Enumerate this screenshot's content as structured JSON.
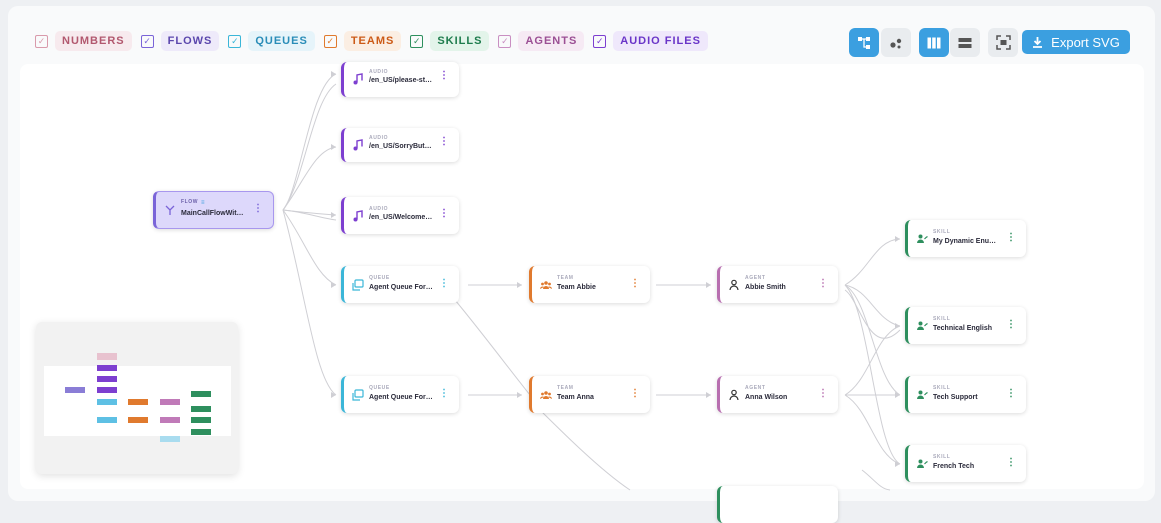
{
  "filters": [
    {
      "label": "NUMBERS",
      "checked": true,
      "color": "#b2586f",
      "bg": "#f7eaee"
    },
    {
      "label": "FLOWS",
      "checked": true,
      "color": "#5a46ad",
      "bg": "#eeeafa"
    },
    {
      "label": "QUEUES",
      "checked": true,
      "color": "#2a8db8",
      "bg": "#e6f4fa"
    },
    {
      "label": "TEAMS",
      "checked": true,
      "color": "#cc5a17",
      "bg": "#fbeee3"
    },
    {
      "label": "SKILLS",
      "checked": true,
      "color": "#1e7c4d",
      "bg": "#e3f4ea"
    },
    {
      "label": "AGENTS",
      "checked": true,
      "color": "#9b4f94",
      "bg": "#f6eaf4"
    },
    {
      "label": "AUDIO FILES",
      "checked": true,
      "color": "#6a35c8",
      "bg": "#efe8fb"
    }
  ],
  "toolbar": {
    "layout_tree_icon": "tree-layout-icon",
    "layout_graph_icon": "graph-layout-icon",
    "columns_icon": "columns-icon",
    "rows_icon": "rows-icon",
    "fit_icon": "fit-view-icon",
    "export_label": "Export SVG"
  },
  "nodes": {
    "audio1": {
      "type": "AUDIO",
      "label": "/en_US/please-st…"
    },
    "audio2": {
      "type": "AUDIO",
      "label": "/en_US/SorryBut…"
    },
    "flow": {
      "type": "FLOW",
      "label": "MainCallFlowWit…"
    },
    "audio3": {
      "type": "AUDIO",
      "label": "/en_US/Welcome…"
    },
    "queue1": {
      "type": "QUEUE",
      "label": "Agent Queue For…"
    },
    "queue2": {
      "type": "QUEUE",
      "label": "Agent Queue For…"
    },
    "team1": {
      "type": "TEAM",
      "label": "Team Abbie"
    },
    "team2": {
      "type": "TEAM",
      "label": "Team Anna"
    },
    "agent1": {
      "type": "AGENT",
      "label": "Abbie Smith"
    },
    "agent2": {
      "type": "AGENT",
      "label": "Anna Wilson"
    },
    "skill1": {
      "type": "SKILL",
      "label": "My Dynamic Enu…"
    },
    "skill2": {
      "type": "SKILL",
      "label": "Technical English"
    },
    "skill3": {
      "type": "SKILL",
      "label": "Tech Support"
    },
    "skill4": {
      "type": "SKILL",
      "label": "French Tech"
    }
  },
  "colors": {
    "audio": "#7d3fd0",
    "flow": "#7a64d8",
    "queue": "#3bb6d8",
    "team": "#e07a2e",
    "agent": "#b86fb0",
    "skill": "#2e8f5e",
    "accent": "#3b9fe0"
  }
}
